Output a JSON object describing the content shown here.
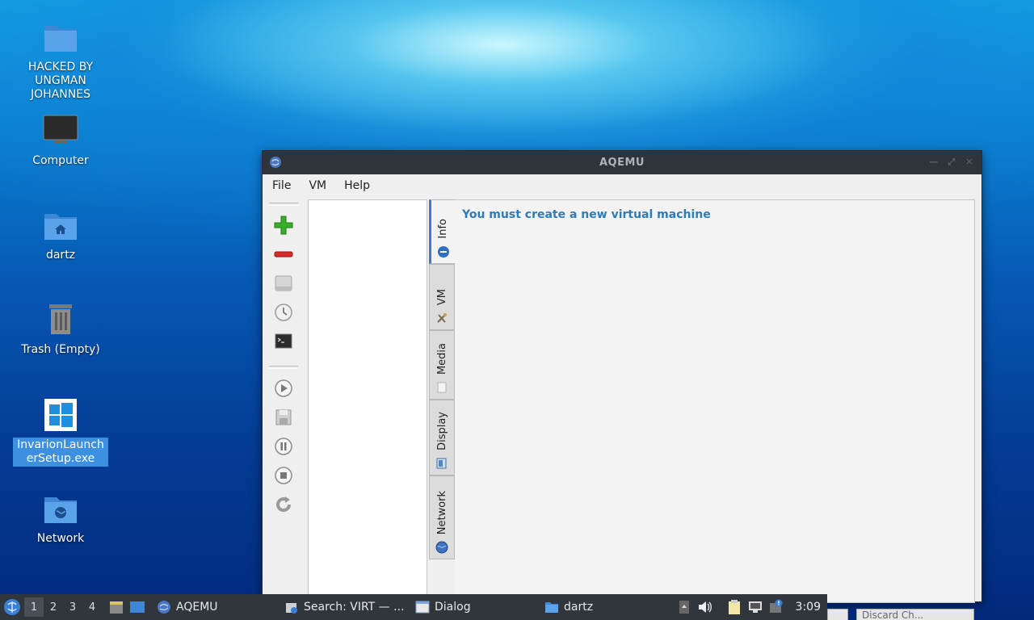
{
  "desktop": {
    "icons": [
      {
        "label": "HACKED BY UNGMAN JOHANNES",
        "icon": "folder-icon"
      },
      {
        "label": "Computer",
        "icon": "computer-icon"
      },
      {
        "label": "dartz",
        "icon": "home-folder-icon"
      },
      {
        "label": "Trash (Empty)",
        "icon": "trash-icon"
      },
      {
        "label": "InvarionLauncherSetup.exe",
        "icon": "windows-exe-icon"
      },
      {
        "label": "Network",
        "icon": "network-folder-icon"
      }
    ]
  },
  "window": {
    "title": "AQEMU",
    "menu": [
      "File",
      "VM",
      "Help"
    ],
    "toolbar_icons": [
      "add-vm-icon",
      "remove-vm-icon",
      "hdd-icon",
      "clock-icon",
      "terminal-icon",
      "play-icon",
      "save-icon",
      "pause-icon",
      "stop-icon",
      "reload-icon"
    ],
    "tabs": [
      {
        "label": "Info",
        "icon": "info-icon"
      },
      {
        "label": "VM",
        "icon": "tools-icon"
      },
      {
        "label": "Media",
        "icon": "media-icon"
      },
      {
        "label": "Display",
        "icon": "display-icon"
      },
      {
        "label": "Network",
        "icon": "network-icon"
      }
    ],
    "info_message": "You must create a new virtual machine",
    "bottom_buttons": [
      "",
      "Discard Ch..."
    ]
  },
  "taskbar": {
    "workspaces": [
      "1",
      "2",
      "3",
      "4"
    ],
    "tasks": [
      {
        "label": "AQEMU",
        "icon": "aqemu-icon"
      },
      {
        "label": "Search: VIRT — ...",
        "icon": "search-app-icon"
      },
      {
        "label": "Dialog",
        "icon": "window-icon"
      },
      {
        "label": "dartz",
        "icon": "folder-icon"
      }
    ],
    "clock": "3:09"
  },
  "colors": {
    "accent": "#3a7bd5",
    "message": "#2f7bb6",
    "titlebar": "#2f333a",
    "taskbar": "#31363d"
  }
}
